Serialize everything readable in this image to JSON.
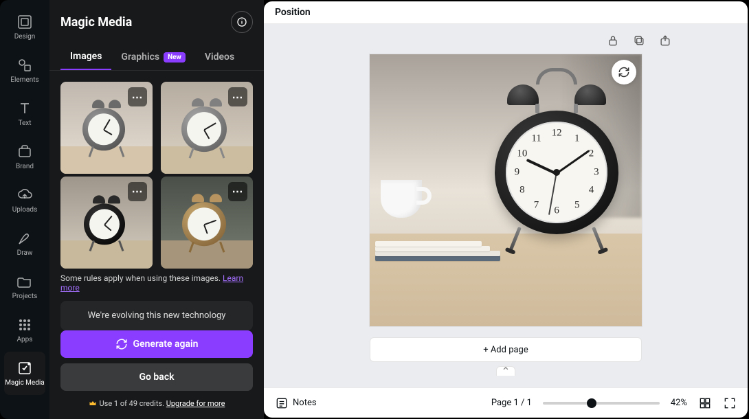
{
  "iconbar": [
    {
      "label": "Design"
    },
    {
      "label": "Elements"
    },
    {
      "label": "Text"
    },
    {
      "label": "Brand"
    },
    {
      "label": "Uploads"
    },
    {
      "label": "Draw"
    },
    {
      "label": "Projects"
    },
    {
      "label": "Apps"
    },
    {
      "label": "Magic Media"
    }
  ],
  "panel": {
    "title": "Magic Media",
    "tabs": [
      {
        "label": "Images",
        "active": true
      },
      {
        "label": "Graphics",
        "badge": "New"
      },
      {
        "label": "Videos"
      }
    ],
    "rules_text": "Some rules apply when using these images. ",
    "rules_link": "Learn more",
    "evolve_text": "We're evolving this new technology",
    "generate_label": "Generate again",
    "back_label": "Go back",
    "credits_text": "Use 1 of 49 credits. ",
    "credits_link": "Upgrade for more"
  },
  "toolbar": {
    "position_label": "Position"
  },
  "stage": {
    "add_page_label": "+ Add page"
  },
  "bottombar": {
    "notes_label": "Notes",
    "page_label": "Page 1 / 1",
    "zoom_label": "42%",
    "zoom_value": 42
  }
}
